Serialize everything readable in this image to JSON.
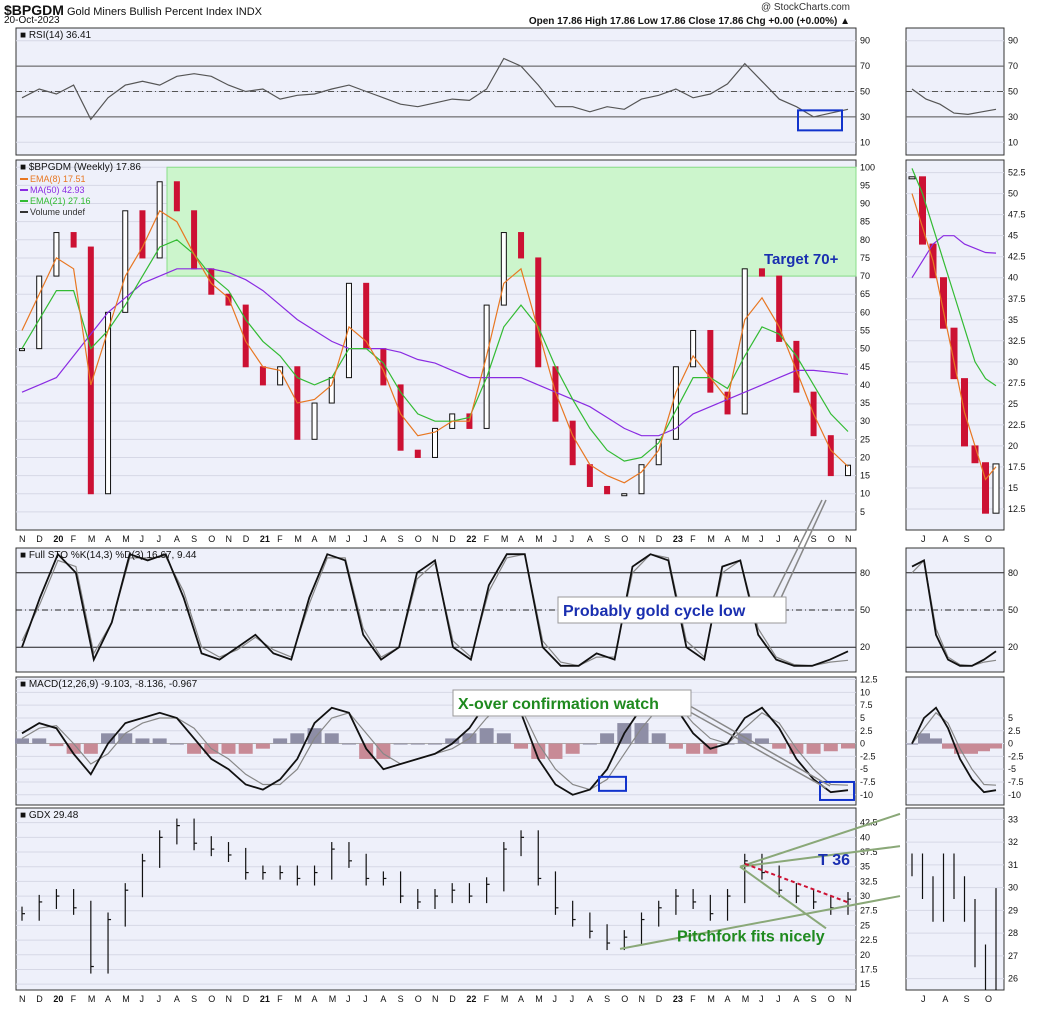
{
  "header": {
    "symbol": "$BPGDM",
    "name": "Gold Miners Bullish Percent Index",
    "exchange": "INDX",
    "date": "20-Oct-2023",
    "credit": "@ StockCharts.com",
    "quote": "Open 17.86  High 17.86  Low 17.86  Close 17.86  Chg +0.00 (+0.00%) ▲"
  },
  "chart_data": [
    {
      "type": "line",
      "panel": "rsi",
      "title": "RSI(14) 36.41",
      "ylim": [
        0,
        100
      ],
      "ticks": [
        90,
        70,
        50,
        30,
        10
      ],
      "reference_lines": [
        70,
        50,
        30
      ],
      "x": [
        "N",
        "D",
        "20",
        "F",
        "M",
        "A",
        "M",
        "J",
        "J",
        "A",
        "S",
        "O",
        "N",
        "D",
        "21",
        "F",
        "M",
        "A",
        "M",
        "J",
        "J",
        "A",
        "S",
        "O",
        "N",
        "D",
        "22",
        "F",
        "M",
        "A",
        "M",
        "J",
        "J",
        "A",
        "S",
        "O",
        "N",
        "D",
        "23",
        "F",
        "M",
        "A",
        "M",
        "J",
        "J",
        "A",
        "S",
        "O",
        "N"
      ],
      "series": [
        {
          "values": [
            45,
            52,
            48,
            55,
            28,
            45,
            55,
            58,
            55,
            62,
            64,
            62,
            55,
            50,
            52,
            44,
            47,
            48,
            52,
            55,
            50,
            45,
            40,
            38,
            41,
            44,
            43,
            52,
            76,
            70,
            55,
            38,
            38,
            34,
            38,
            36,
            44,
            47,
            52,
            45,
            48,
            56,
            72,
            58,
            44,
            38,
            30,
            33,
            36
          ]
        }
      ],
      "inset_series": [
        52,
        44,
        40,
        33,
        32,
        34,
        36
      ]
    },
    {
      "type": "bar",
      "panel": "price",
      "title": "$BPGDM (Weekly) 17.86",
      "legend": [
        {
          "label": "EMA(8) 17.51",
          "color": "#e87722"
        },
        {
          "label": "MA(50) 42.93",
          "color": "#8a2be2"
        },
        {
          "label": "EMA(21) 27.16",
          "color": "#33bb33"
        },
        {
          "label": "Volume undef",
          "color": "#333333"
        }
      ],
      "ylim": [
        0,
        102
      ],
      "ticks": [
        100,
        95,
        90,
        85,
        80,
        75,
        70,
        65,
        60,
        55,
        50,
        45,
        40,
        35,
        30,
        25,
        20,
        15,
        10,
        5
      ],
      "inset_ticks": [
        52.5,
        50.0,
        47.5,
        45.0,
        42.5,
        40.0,
        37.5,
        35.0,
        32.5,
        30.0,
        27.5,
        25.0,
        22.5,
        20.0,
        17.5,
        15.0,
        12.5
      ],
      "inset_ylim": [
        10,
        54
      ],
      "target_zone": [
        70,
        100
      ],
      "target_label": "Target 70+",
      "annotation": "Probably gold cycle low",
      "x": [
        "N",
        "D",
        "20",
        "F",
        "M",
        "A",
        "M",
        "J",
        "J",
        "A",
        "S",
        "O",
        "N",
        "D",
        "21",
        "F",
        "M",
        "A",
        "M",
        "J",
        "J",
        "A",
        "S",
        "O",
        "N",
        "D",
        "22",
        "F",
        "M",
        "A",
        "M",
        "J",
        "J",
        "A",
        "S",
        "O",
        "N",
        "D",
        "23",
        "F",
        "M",
        "A",
        "M",
        "J",
        "J",
        "A",
        "S",
        "O",
        "N"
      ],
      "close": [
        50,
        70,
        82,
        78,
        10,
        60,
        88,
        75,
        96,
        88,
        72,
        65,
        62,
        45,
        40,
        45,
        25,
        35,
        42,
        68,
        50,
        40,
        22,
        20,
        28,
        32,
        28,
        62,
        82,
        75,
        45,
        30,
        18,
        12,
        10,
        10,
        18,
        25,
        45,
        55,
        38,
        32,
        72,
        70,
        52,
        38,
        26,
        15,
        17.86
      ],
      "ema8": [
        55,
        65,
        75,
        72,
        40,
        55,
        70,
        78,
        88,
        85,
        76,
        68,
        64,
        52,
        45,
        44,
        35,
        36,
        40,
        56,
        52,
        44,
        32,
        26,
        27,
        30,
        30,
        48,
        68,
        72,
        55,
        38,
        26,
        18,
        15,
        13,
        16,
        22,
        38,
        48,
        42,
        36,
        58,
        64,
        56,
        44,
        32,
        22,
        17.51
      ],
      "ema21": [
        50,
        58,
        66,
        66,
        50,
        55,
        62,
        70,
        78,
        80,
        76,
        70,
        66,
        58,
        52,
        48,
        42,
        40,
        42,
        50,
        50,
        46,
        38,
        32,
        30,
        30,
        31,
        42,
        56,
        62,
        56,
        45,
        36,
        28,
        22,
        19,
        20,
        24,
        33,
        42,
        42,
        39,
        48,
        56,
        54,
        48,
        40,
        32,
        27.16
      ],
      "ma50": [
        38,
        40,
        42,
        48,
        54,
        60,
        64,
        68,
        70,
        72,
        72,
        72,
        71,
        69,
        66,
        62,
        58,
        55,
        52,
        50,
        50,
        50,
        49,
        47,
        46,
        44,
        42,
        42,
        42,
        42,
        40,
        38,
        36,
        34,
        31,
        28,
        26,
        26,
        28,
        32,
        34,
        36,
        38,
        40,
        42,
        44,
        44,
        43.5,
        42.93
      ],
      "inset_close": [
        52,
        44,
        40,
        34,
        28,
        20,
        18,
        12,
        17.86
      ],
      "inset_ema8": [
        50,
        46,
        42,
        36,
        30,
        24,
        20,
        16,
        17.51
      ],
      "inset_ema21": [
        53,
        50,
        46,
        42,
        38,
        34,
        30,
        28,
        27.16
      ],
      "inset_ma50": [
        40,
        42,
        44,
        45,
        45,
        44,
        43.5,
        43,
        42.93
      ]
    },
    {
      "type": "line",
      "panel": "stochastic",
      "title": "Full STO %K(14,3) %D(3) 16.67, 9.44",
      "ylim": [
        0,
        100
      ],
      "ticks": [
        80,
        50,
        20
      ],
      "reference_lines": [
        80,
        50,
        20
      ],
      "series": [
        {
          "name": "%K",
          "values": [
            20,
            60,
            95,
            80,
            10,
            40,
            95,
            90,
            95,
            60,
            15,
            10,
            20,
            30,
            15,
            10,
            60,
            95,
            90,
            30,
            10,
            20,
            80,
            90,
            20,
            10,
            70,
            95,
            95,
            20,
            5,
            5,
            15,
            10,
            85,
            95,
            90,
            20,
            10,
            85,
            90,
            30,
            10,
            5,
            5,
            10,
            16.67
          ]
        },
        {
          "name": "%D",
          "values": [
            25,
            55,
            90,
            85,
            15,
            40,
            92,
            92,
            93,
            65,
            20,
            12,
            18,
            28,
            18,
            12,
            55,
            92,
            92,
            35,
            12,
            20,
            75,
            88,
            25,
            12,
            65,
            92,
            95,
            25,
            8,
            5,
            12,
            12,
            80,
            95,
            92,
            25,
            12,
            80,
            90,
            35,
            12,
            6,
            5,
            8,
            9.44
          ]
        }
      ],
      "annotation": "Probably gold cycle low"
    },
    {
      "type": "bar",
      "panel": "macd",
      "title": "MACD(12,26,9) -9.103, -8.136, -0.967",
      "ylim": [
        -12,
        13
      ],
      "ticks": [
        12.5,
        10.0,
        7.5,
        5.0,
        2.5,
        0.0,
        -2.5,
        -5.0,
        -7.5,
        -10.0
      ],
      "inset_ticks": [
        5.0,
        2.5,
        0.0,
        -2.5,
        -5.0,
        -7.5,
        -10.0
      ],
      "annotation": "X-over confirmation watch",
      "series": [
        {
          "name": "MACD",
          "values": [
            2,
            4,
            3,
            -2,
            -6,
            0,
            4,
            5,
            6,
            5,
            1,
            -3,
            -5,
            -8,
            -9,
            -7,
            -3,
            4,
            7,
            6,
            -1,
            -5,
            -4,
            -3,
            -2,
            0,
            3,
            8,
            10,
            6,
            -3,
            -8,
            -10,
            -9,
            -5,
            2,
            7,
            9,
            7,
            2,
            -1,
            0,
            5,
            7,
            3,
            -3,
            -7,
            -9.5,
            -9.103
          ]
        },
        {
          "name": "Signal",
          "values": [
            1,
            3,
            3.5,
            0,
            -4,
            -2,
            2,
            4,
            5,
            5,
            3,
            -1,
            -3,
            -6,
            -8,
            -8,
            -5,
            1,
            5,
            6,
            2,
            -2,
            -4,
            -3,
            -2,
            -1,
            1,
            5,
            8,
            7,
            0,
            -5,
            -8,
            -9,
            -7,
            -2,
            3,
            7,
            8,
            4,
            1,
            0,
            3,
            6,
            4,
            -1,
            -5,
            -8,
            -8.136
          ]
        },
        {
          "name": "Histogram",
          "values": [
            1,
            1,
            -0.5,
            -2,
            -2,
            2,
            2,
            1,
            1,
            0,
            -2,
            -2,
            -2,
            -2,
            -1,
            1,
            2,
            3,
            2,
            0,
            -3,
            -3,
            0,
            0,
            0,
            1,
            2,
            3,
            2,
            -1,
            -3,
            -3,
            -2,
            0,
            2,
            4,
            4,
            2,
            -1,
            -2,
            -2,
            0,
            2,
            1,
            -1,
            -2,
            -2,
            -1.5,
            -0.967
          ]
        }
      ]
    },
    {
      "type": "bar",
      "panel": "gdx",
      "title": "GDX 29.48",
      "ylim": [
        14,
        45
      ],
      "ticks": [
        42.5,
        40.0,
        37.5,
        35.0,
        32.5,
        30.0,
        27.5,
        25.0,
        22.5,
        20.0,
        17.5,
        15.0
      ],
      "inset_ticks": [
        33,
        32,
        31,
        30,
        29,
        28,
        27,
        26
      ],
      "inset_ylim": [
        25.5,
        33.5
      ],
      "annotations": [
        "T 36",
        "Pitchfork fits nicely"
      ],
      "x_labels": [
        "N",
        "D",
        "20",
        "F",
        "M",
        "A",
        "M",
        "J",
        "J",
        "A",
        "S",
        "O",
        "N",
        "D",
        "21",
        "F",
        "M",
        "A",
        "M",
        "J",
        "J",
        "A",
        "S",
        "O",
        "N",
        "D",
        "22",
        "F",
        "M",
        "A",
        "M",
        "J",
        "J",
        "A",
        "S",
        "O",
        "N",
        "D",
        "23",
        "F",
        "M",
        "A",
        "M",
        "J",
        "J",
        "A",
        "S",
        "O",
        "N"
      ],
      "inset_x_labels": [
        "J",
        "A",
        "S",
        "O"
      ],
      "close": [
        27,
        29,
        30,
        28,
        18,
        26,
        31,
        36,
        40,
        42,
        39,
        38,
        37,
        34,
        34,
        34,
        33,
        34,
        38,
        36,
        33,
        33,
        30,
        29,
        30,
        31,
        30,
        32,
        38,
        40,
        33,
        28,
        26,
        24,
        22,
        23,
        26,
        28,
        30,
        29,
        27,
        30,
        36,
        34,
        31,
        30,
        29,
        28,
        29.48
      ],
      "inset_close": [
        31,
        30,
        29,
        31,
        30,
        29,
        27,
        26,
        29.48
      ]
    }
  ]
}
